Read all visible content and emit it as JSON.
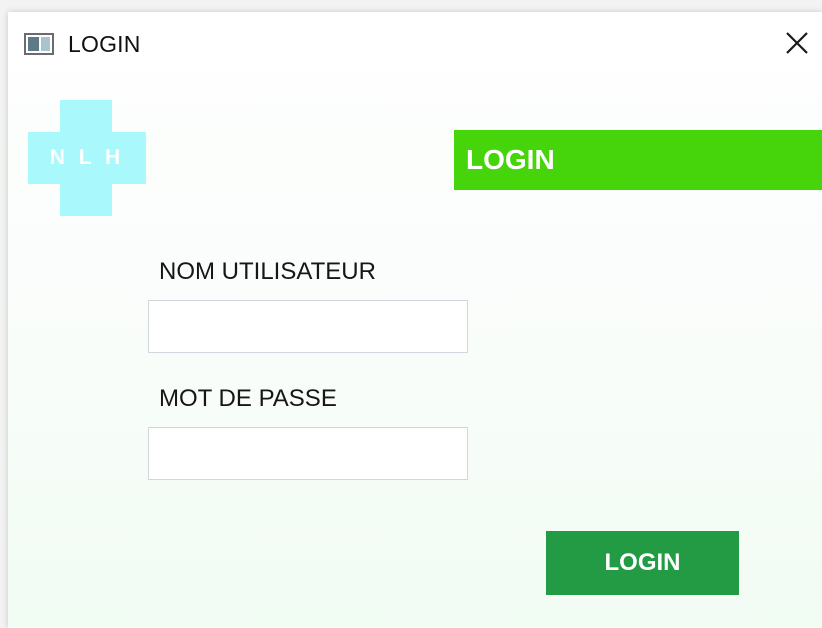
{
  "window": {
    "title": "LOGIN",
    "icon": "app-window-icon",
    "close_icon": "close-icon"
  },
  "logo": {
    "text": "N L H",
    "color": "#a8f8fc"
  },
  "banner": {
    "text": "LOGIN",
    "color": "#46d40a"
  },
  "form": {
    "username": {
      "label": "NOM UTILISATEUR",
      "value": "",
      "placeholder": ""
    },
    "password": {
      "label": "MOT DE PASSE",
      "value": "",
      "placeholder": ""
    },
    "submit_label": "LOGIN",
    "submit_color": "#239b45"
  }
}
